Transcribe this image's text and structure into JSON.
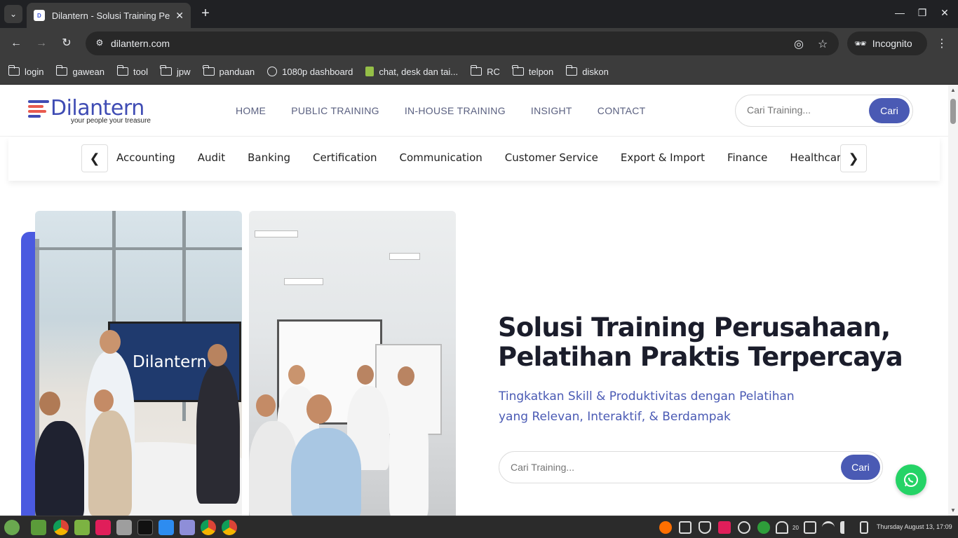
{
  "browser": {
    "tab_title": "Dilantern - Solusi Training Pe",
    "tab_favicon": "D",
    "url": "dilantern.com",
    "incognito_label": "Incognito",
    "bookmarks": [
      {
        "label": "login",
        "icon": "folder-icon"
      },
      {
        "label": "gawean",
        "icon": "folder-icon"
      },
      {
        "label": "tool",
        "icon": "folder-icon"
      },
      {
        "label": "jpw",
        "icon": "folder-icon"
      },
      {
        "label": "panduan",
        "icon": "folder-icon"
      },
      {
        "label": "1080p dashboard",
        "icon": "globe-icon"
      },
      {
        "label": "chat, desk dan tai...",
        "icon": "shopify-icon"
      },
      {
        "label": "RC",
        "icon": "folder-icon"
      },
      {
        "label": "telpon",
        "icon": "folder-icon"
      },
      {
        "label": "diskon",
        "icon": "folder-icon"
      }
    ]
  },
  "site": {
    "logo_text": "Dilantern",
    "logo_tagline": "your people your treasure",
    "nav": [
      "HOME",
      "PUBLIC TRAINING",
      "IN-HOUSE TRAINING",
      "INSIGHT",
      "CONTACT"
    ],
    "header_search": {
      "placeholder": "Cari Training...",
      "button": "Cari"
    },
    "categories": [
      "Accounting",
      "Audit",
      "Banking",
      "Certification",
      "Communication",
      "Customer Service",
      "Export & Import",
      "Finance",
      "Healthcare"
    ],
    "cat_prev": "❮",
    "cat_next": "❯",
    "board_text": "Dilantern",
    "hero": {
      "title_line1": "Solusi Training Perusahaan,",
      "title_line2": "Pelatihan Praktis Terpercaya",
      "subtitle_line1": "Tingkatkan Skill & Produktivitas dengan Pelatihan",
      "subtitle_line2": "yang Relevan, Interaktif, & Berdampak",
      "search_placeholder": "Cari Training...",
      "search_button": "Cari"
    }
  },
  "taskbar": {
    "tray_number": "20",
    "clock": "Thursday August 13, 17:09"
  },
  "colors": {
    "brand_blue": "#4a5ab4",
    "accent_bar": "#4a5ae0",
    "logo_red": "#e85a4f",
    "whatsapp": "#25d366"
  }
}
